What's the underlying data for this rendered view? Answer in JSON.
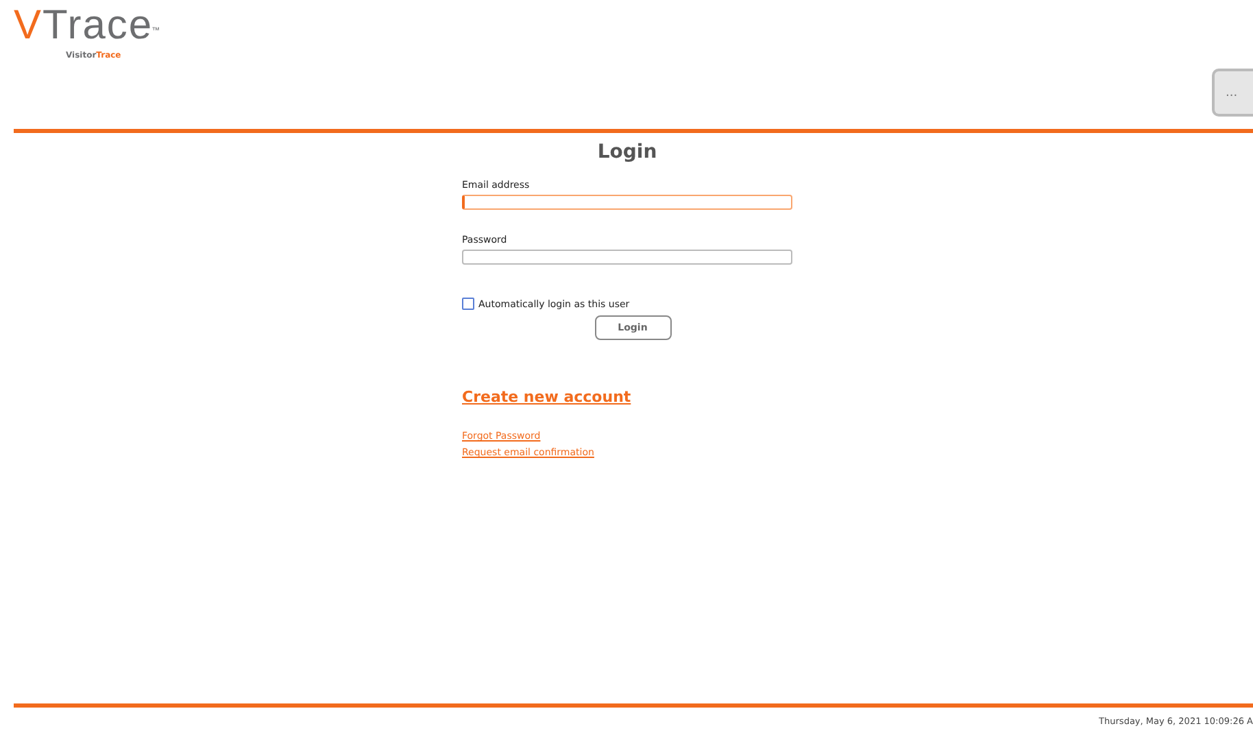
{
  "header": {
    "logo": {
      "initial": "V",
      "name": "Trace",
      "trademark": "™"
    },
    "tagline": {
      "first": "Visitor",
      "second": "Trace"
    },
    "menu_button": "..."
  },
  "login": {
    "title": "Login",
    "fields": [
      {
        "label": "Email address",
        "focused": true
      },
      {
        "label": "Password",
        "focused": false
      }
    ],
    "remember": {
      "label": "Automatically login as this user",
      "checked": false
    },
    "button": "Login",
    "create_account": "Create new account",
    "links": [
      "Forgot Password",
      "Request email confirmation"
    ]
  },
  "footer": {
    "datetime": "Thursday, May 6, 2021 10:09:26 A"
  }
}
